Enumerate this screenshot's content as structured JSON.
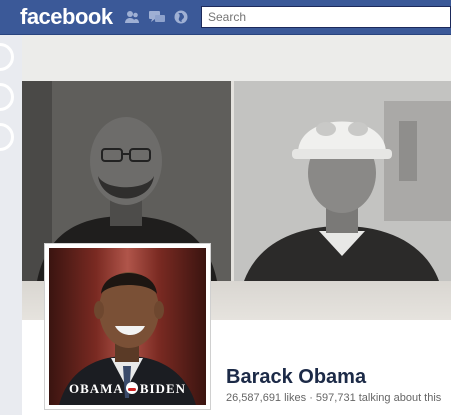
{
  "header": {
    "logo_text": "facebook",
    "search": {
      "placeholder": "Search",
      "value": ""
    },
    "icons": [
      "friend-requests-icon",
      "messages-icon",
      "notifications-icon"
    ]
  },
  "profile": {
    "name": "Barack Obama",
    "likes": "26,587,691 likes",
    "separator": "·",
    "talking": "597,731 talking about this",
    "campaign_left": "OBAMA",
    "campaign_right": "BIDEN"
  },
  "colors": {
    "brand_blue": "#3b5998",
    "name_color": "#1c2a47"
  }
}
